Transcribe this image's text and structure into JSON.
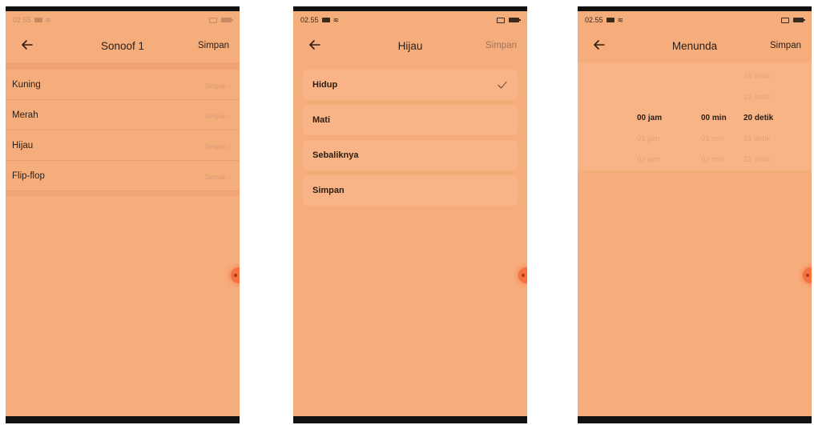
{
  "screens": [
    {
      "status": {
        "time": "02.55"
      },
      "header": {
        "title": "Sonoof 1",
        "action": "Simpan"
      },
      "items": [
        {
          "label": "Kuning",
          "value": "Simpan"
        },
        {
          "label": "Merah",
          "value": "Simpan"
        },
        {
          "label": "Hijau",
          "value": "Simpan"
        },
        {
          "label": "Flip-flop",
          "value": "Simpan"
        }
      ]
    },
    {
      "status": {
        "time": "02.55"
      },
      "header": {
        "title": "Hijau",
        "action": "Simpan"
      },
      "options": [
        {
          "label": "Hidup",
          "selected": true
        },
        {
          "label": "Mati",
          "selected": false
        },
        {
          "label": "Sebaliknya",
          "selected": false
        },
        {
          "label": "Simpan",
          "selected": false
        }
      ]
    },
    {
      "status": {
        "time": "02.55"
      },
      "header": {
        "title": "Menunda",
        "action": "Simpan"
      },
      "picker": {
        "hours": [
          "00 jam",
          "01 jam",
          "02 jam"
        ],
        "minutes": [
          "00 min",
          "01 min",
          "02 min"
        ],
        "seconds": [
          "18 detik",
          "19 detik",
          "20 detik",
          "21 detik",
          "22 detik"
        ],
        "selected": {
          "hours": "00 jam",
          "minutes": "00 min",
          "seconds": "20 detik"
        }
      }
    }
  ],
  "icons": {
    "back": "arrow-left-icon",
    "check": "check-icon",
    "chevron": "chevron-right-icon"
  },
  "colors": {
    "background": "#f6ad7c",
    "accent": "#f5713e",
    "text": "#2b1d12",
    "muted": "#d89a72"
  }
}
